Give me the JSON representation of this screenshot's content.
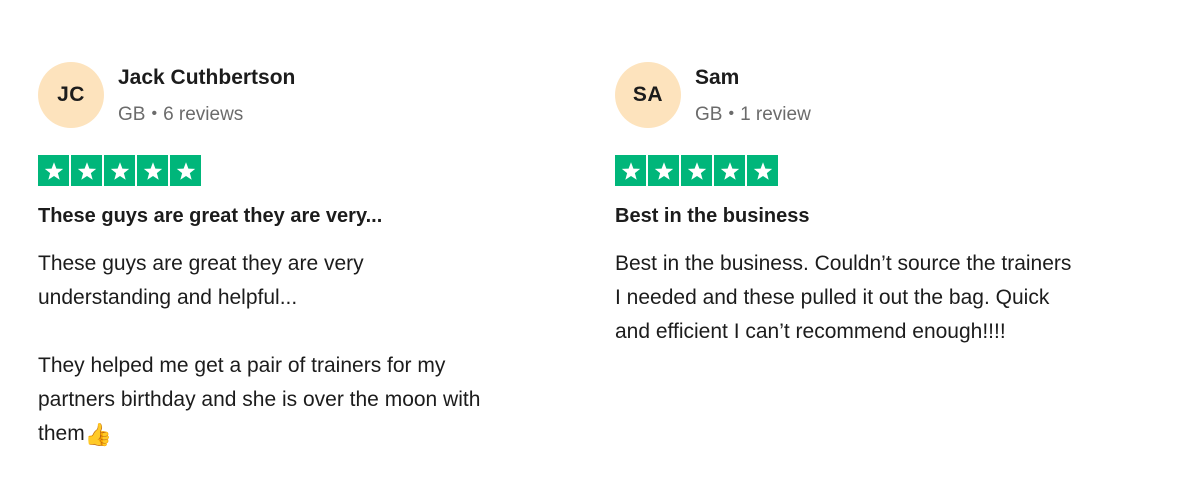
{
  "reviews": [
    {
      "initials": "JC",
      "name": "Jack Cuthbertson",
      "country": "GB",
      "review_count": "6 reviews",
      "rating": 5,
      "title": "These guys are great they are very...",
      "body": "These guys are great they are very\nunderstanding and helpful...\n\nThey helped me get a pair of trainers for my\npartners birthday and she is over the moon with\nthem",
      "emoji": "👍",
      "avatar_color": "#fde3bd"
    },
    {
      "initials": "SA",
      "name": "Sam",
      "country": "GB",
      "review_count": "1 review",
      "rating": 5,
      "title": "Best in the business",
      "body": "Best in the business. Couldn’t source the trainers\nI needed and these pulled it out the bag. Quick\nand efficient I can’t recommend enough!!!!",
      "avatar_color": "#fde3bd"
    }
  ],
  "star_color": "#00b67a"
}
